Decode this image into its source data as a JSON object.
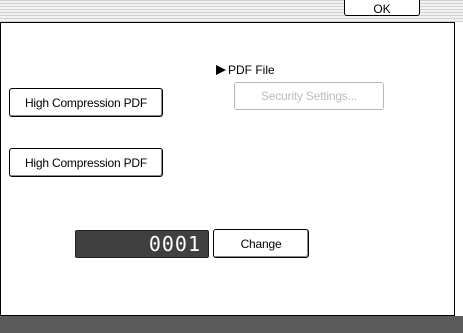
{
  "top": {
    "tab_label": "OK"
  },
  "pdf": {
    "file_label": "PDF File",
    "security_settings_label": "Security Settings..."
  },
  "compression": {
    "button1_label": "High Compression PDF",
    "button2_label": "High Compression PDF"
  },
  "counter": {
    "value": "0001"
  },
  "change_button_label": "Change",
  "colors": {
    "counter_bg": "#404040",
    "status_bar": "#5b5b5b",
    "disabled_text": "#bdbdbd"
  }
}
